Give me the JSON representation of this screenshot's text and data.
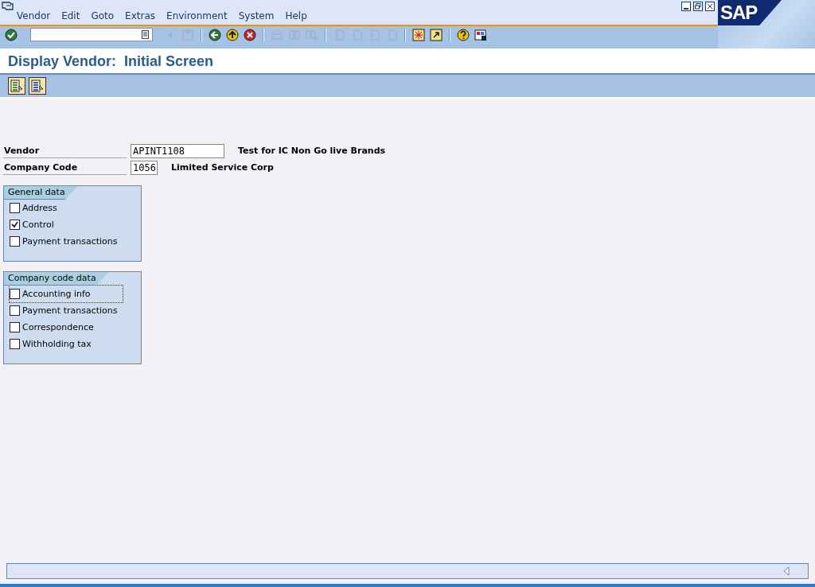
{
  "menu": [
    {
      "label": "Vendor"
    },
    {
      "label": "Edit"
    },
    {
      "label": "Goto"
    },
    {
      "label": "Extras"
    },
    {
      "label": "Environment"
    },
    {
      "label": "System"
    },
    {
      "label": "Help"
    }
  ],
  "logo": "SAP",
  "toolbar": [
    {
      "kind": "enter",
      "disabled": false
    },
    {
      "kind": "command"
    },
    {
      "kind": "prev",
      "disabled": true
    },
    {
      "kind": "save",
      "disabled": true
    },
    {
      "kind": "sep"
    },
    {
      "kind": "back",
      "disabled": false
    },
    {
      "kind": "exit",
      "disabled": false
    },
    {
      "kind": "cancel",
      "disabled": false
    },
    {
      "kind": "sep"
    },
    {
      "kind": "print",
      "disabled": true
    },
    {
      "kind": "find",
      "disabled": true
    },
    {
      "kind": "findnext",
      "disabled": true
    },
    {
      "kind": "sep"
    },
    {
      "kind": "page",
      "disabled": true
    },
    {
      "kind": "page",
      "disabled": true
    },
    {
      "kind": "page",
      "disabled": true
    },
    {
      "kind": "page",
      "disabled": true
    },
    {
      "kind": "sep"
    },
    {
      "kind": "session",
      "disabled": false
    },
    {
      "kind": "shortcut",
      "disabled": false
    },
    {
      "kind": "sep"
    },
    {
      "kind": "help",
      "disabled": false
    },
    {
      "kind": "layout",
      "disabled": false
    }
  ],
  "title": "Display Vendor:  Initial Screen",
  "app_toolbar": [
    {
      "kind": "green"
    },
    {
      "kind": "blue"
    }
  ],
  "fields": [
    {
      "label": "Vendor",
      "value": "APINT1108",
      "description": "Test for IC Non Go live Brands"
    },
    {
      "label": "Company Code",
      "value": "1056",
      "description": "Limited Service Corp"
    }
  ],
  "groups": [
    {
      "title": "General data",
      "items": [
        {
          "label": "Address",
          "checked": false,
          "focused": false
        },
        {
          "label": "Control",
          "checked": true,
          "focused": false
        },
        {
          "label": "Payment transactions",
          "checked": false,
          "focused": false
        }
      ]
    },
    {
      "title": "Company code data",
      "items": [
        {
          "label": "Accounting info",
          "checked": false,
          "focused": true
        },
        {
          "label": "Payment transactions",
          "checked": false,
          "focused": false
        },
        {
          "label": "Correspondence",
          "checked": false,
          "focused": false
        },
        {
          "label": "Withholding tax",
          "checked": false,
          "focused": false
        }
      ]
    }
  ]
}
